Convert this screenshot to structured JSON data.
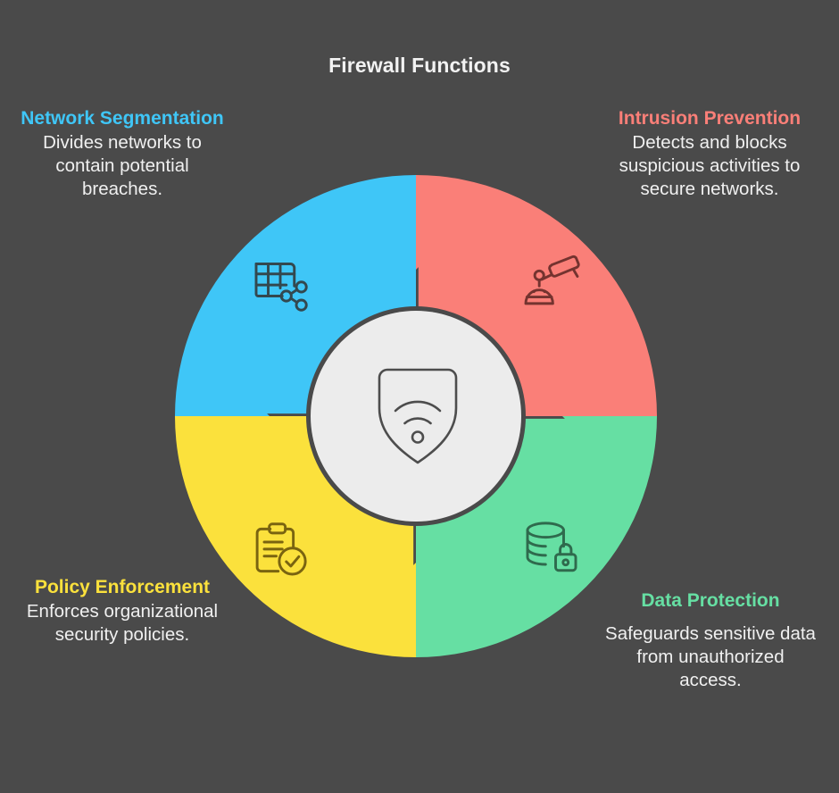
{
  "title": "Firewall Functions",
  "background_color": "#4a4a4a",
  "center": {
    "icon": "shield-wifi-icon",
    "circle_color": "#ececec",
    "icon_stroke": "#4d4d4d"
  },
  "segments": [
    {
      "id": "network-segmentation",
      "title": "Network Segmentation",
      "description": "Divides networks to contain potential breaches.",
      "color": "#3fc6f7",
      "icon": "table-share-network-icon",
      "position": "top-left"
    },
    {
      "id": "intrusion-prevention",
      "title": "Intrusion Prevention",
      "description": "Detects and blocks suspicious activities to secure networks.",
      "color": "#fa7f78",
      "icon": "cctv-camera-intruder-icon",
      "position": "top-right"
    },
    {
      "id": "data-protection",
      "title": "Data Protection",
      "description": "Safeguards sensitive data from unauthorized access.",
      "color": "#66dfa3",
      "icon": "database-lock-icon",
      "position": "bottom-right"
    },
    {
      "id": "policy-enforcement",
      "title": "Policy Enforcement",
      "description": "Enforces organizational security policies.",
      "color": "#fbe13c",
      "icon": "clipboard-check-icon",
      "position": "bottom-left"
    }
  ]
}
